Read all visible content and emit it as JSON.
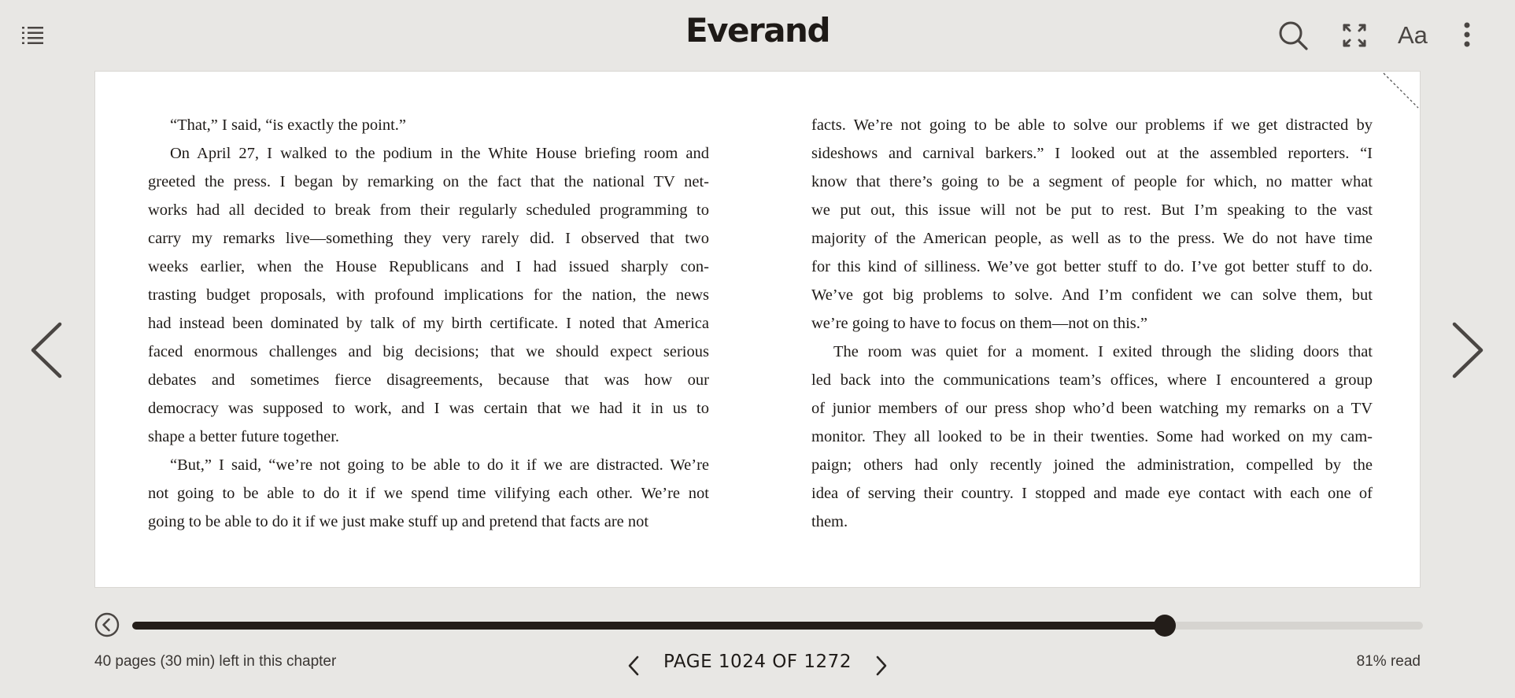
{
  "header": {
    "brand": "Everand",
    "font_button_label": "Aa"
  },
  "icons": {
    "toc": "list-icon",
    "search": "search-icon",
    "fullscreen": "expand-icon",
    "more": "more-vertical-icon",
    "prev_page": "chevron-left-icon",
    "next_page": "chevron-right-icon",
    "back": "back-circle-icon"
  },
  "book": {
    "left_column": [
      "“That,” I said, “is exactly the point.”",
      "On April 27, I walked to the podium in the White House briefing room and",
      "greeted the press. I began by remarking on the fact that the national TV net-",
      "works had all decided to break from their regularly scheduled programming to",
      "carry my remarks live—something they very rarely did. I observed that two",
      "weeks earlier, when the House Republicans and I had issued sharply con-",
      "trasting budget proposals, with profound implications for the nation, the news",
      "had instead been dominated by talk of my birth certificate. I noted that America",
      "faced enormous challenges and big decisions; that we should expect serious",
      "debates and sometimes fierce disagreements, because that was how our",
      "democracy was supposed to work, and I was certain that we had it in us to",
      "shape a better future together.",
      "“But,” I said, “we’re not going to be able to do it if we are distracted. We’re",
      "not going to be able to do it if we spend time vilifying each other. We’re not",
      "going to be able to do it if we just make stuff up and pretend that facts are not"
    ],
    "right_column": [
      "facts. We’re not going to be able to solve our problems if we get distracted by",
      "sideshows and carnival barkers.” I looked out at the assembled reporters. “I",
      "know that there’s going to be a segment of people for which, no matter what",
      "we put out, this issue will not be put to rest. But I’m speaking to the vast",
      "majority of the American people, as well as to the press. We do not have time",
      "for this kind of silliness. We’ve got better stuff to do. I’ve got better stuff to do.",
      "We’ve got big problems to solve. And I’m confident we can solve them, but",
      "we’re going to have to focus on them—not on this.”",
      "The room was quiet for a moment. I exited through the sliding doors that",
      "led back into the communications team’s offices, where I encountered a group",
      "of junior members of our press shop who’d been watching my remarks on a TV",
      "monitor. They all looked to be in their twenties. Some had worked on my cam-",
      "paign; others had only recently joined the administration, compelled by the",
      "idea of serving their country. I stopped and made eye contact with each one of",
      "them."
    ]
  },
  "footer": {
    "chapter_remaining": "40 pages (30 min) left in this chapter",
    "page_indicator": "PAGE 1024 OF 1272",
    "read_percent": "81% read",
    "progress_fraction": 0.8
  },
  "colors": {
    "background": "#e8e7e4",
    "page": "#ffffff",
    "text": "#1e1a17",
    "progress_fill": "#231d19",
    "progress_track": "#d6d4d0"
  }
}
